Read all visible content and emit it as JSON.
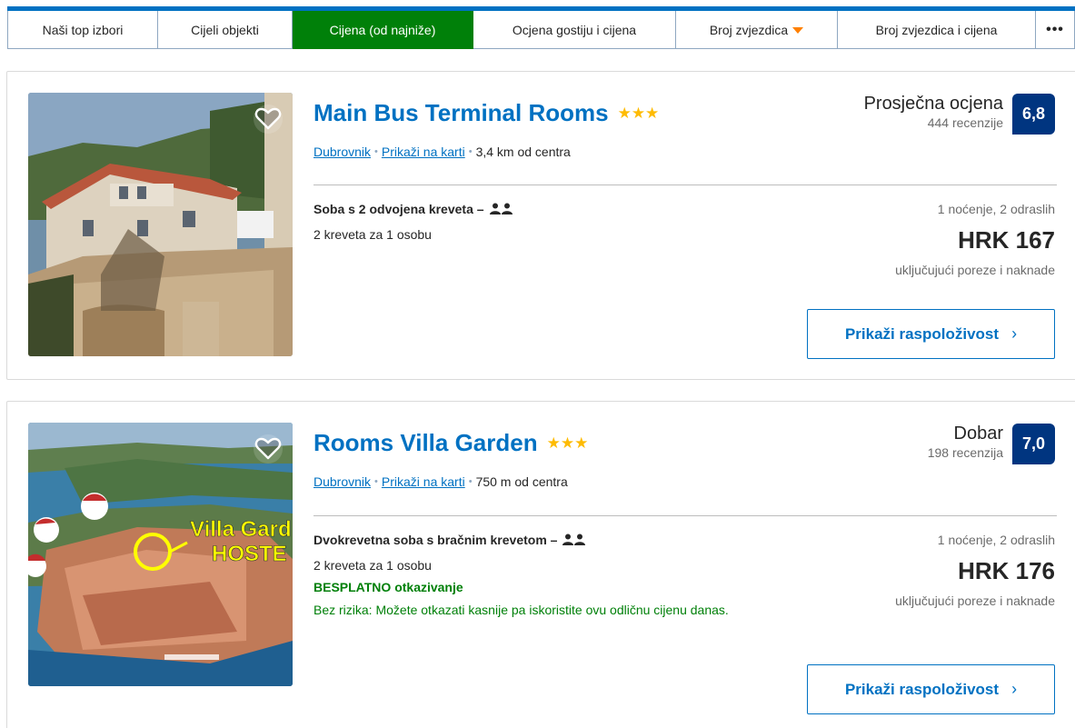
{
  "sort_tabs": [
    {
      "label": "Naši top izbori",
      "active": false
    },
    {
      "label": "Cijeli objekti",
      "active": false
    },
    {
      "label": "Cijena (od najniže)",
      "active": true
    },
    {
      "label": "Ocjena gostiju i cijena",
      "active": false
    },
    {
      "label": "Broj zvjezdica",
      "active": false,
      "has_dropdown": true
    },
    {
      "label": "Broj zvjezdica i cijena",
      "active": false
    },
    {
      "label": "•••",
      "active": false,
      "icon": "more-dots-icon"
    }
  ],
  "properties": [
    {
      "name": "Main Bus Terminal Rooms",
      "stars": "★★★",
      "star_count": 3,
      "city": "Dubrovnik",
      "map_link": "Prikaži na karti",
      "distance": "3,4 km od centra",
      "rating_word": "Prosječna ocjena",
      "reviews": "444 recenzije",
      "score": "6,8",
      "room_type": "Soba s 2 odvojena kreveta –",
      "beds": "2 kreveta za 1 osobu",
      "stay": "1 noćenje, 2 odraslih",
      "price": "HRK 167",
      "price_note": "uključujući poreze i naknade",
      "button": "Prikaži raspoloživost"
    },
    {
      "name": "Rooms Villa Garden",
      "stars": "★★★",
      "star_count": 3,
      "city": "Dubrovnik",
      "map_link": "Prikaži na karti",
      "distance": "750 m od centra",
      "rating_word": "Dobar",
      "reviews": "198 recenzija",
      "score": "7,0",
      "room_type": "Dvokrevetna soba s bračnim krevetom –",
      "beds": "2 kreveta za 1 osobu",
      "free_cancel": "BESPLATNO otkazivanje",
      "risk_text": "Bez rizika: Možete otkazati kasnije pa iskoristite ovu odličnu cijenu danas.",
      "photo_text_1": "Villa Gard",
      "photo_text_2": "HOSTE",
      "stay": "1 noćenje, 2 odraslih",
      "price": "HRK 176",
      "price_note": "uključujući poreze i naknade",
      "button": "Prikaži raspoloživost"
    }
  ],
  "colors": {
    "brand_blue": "#0071c2",
    "dark_blue": "#003580",
    "active_green": "#008009",
    "star_yellow": "#febb02",
    "caret_orange": "#ff8000"
  }
}
